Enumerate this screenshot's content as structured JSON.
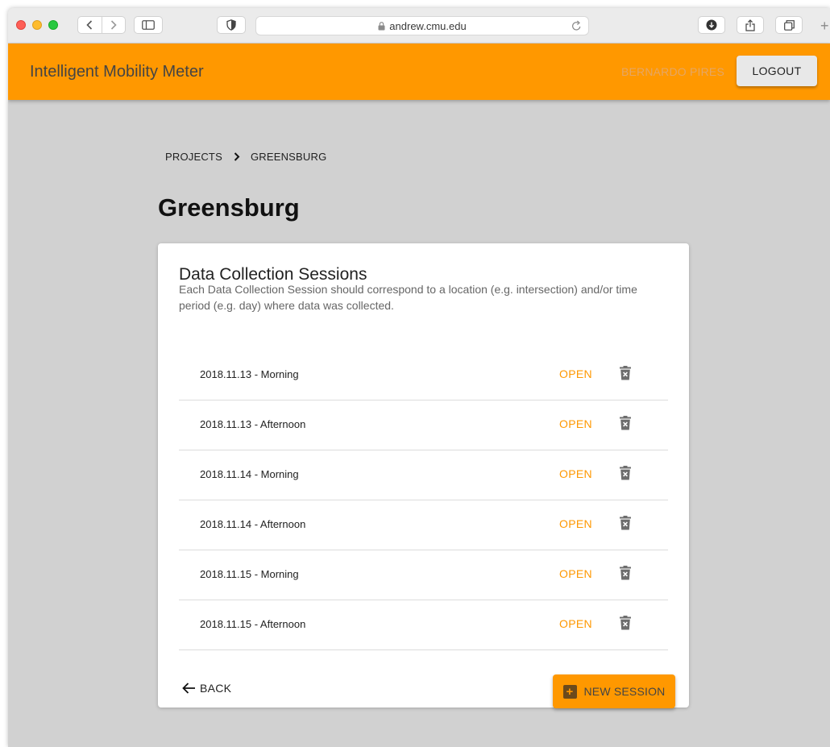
{
  "browser": {
    "url": "andrew.cmu.edu"
  },
  "appbar": {
    "title": "Intelligent Mobility Meter",
    "user_name": "BERNARDO PIRES",
    "logout_label": "LOGOUT",
    "color": "#ff9800"
  },
  "breadcrumb": {
    "items": [
      "PROJECTS",
      "GREENSBURG"
    ]
  },
  "page": {
    "title": "Greensburg"
  },
  "card": {
    "title": "Data Collection Sessions",
    "description": "Each Data Collection Session should correspond to a location (e.g. intersection) and/or time period (e.g. day) where data was collected.",
    "open_label": "OPEN",
    "sessions": [
      {
        "name": "2018.11.13 - Morning"
      },
      {
        "name": "2018.11.13 - Afternoon"
      },
      {
        "name": "2018.11.14 - Morning"
      },
      {
        "name": "2018.11.14 - Afternoon"
      },
      {
        "name": "2018.11.15 - Morning"
      },
      {
        "name": "2018.11.15 - Afternoon"
      }
    ],
    "back_label": "BACK",
    "new_session_label": "NEW SESSION"
  },
  "icons": {
    "delete": "delete-icon",
    "back": "arrow-left-icon",
    "add": "plus-box-icon"
  }
}
